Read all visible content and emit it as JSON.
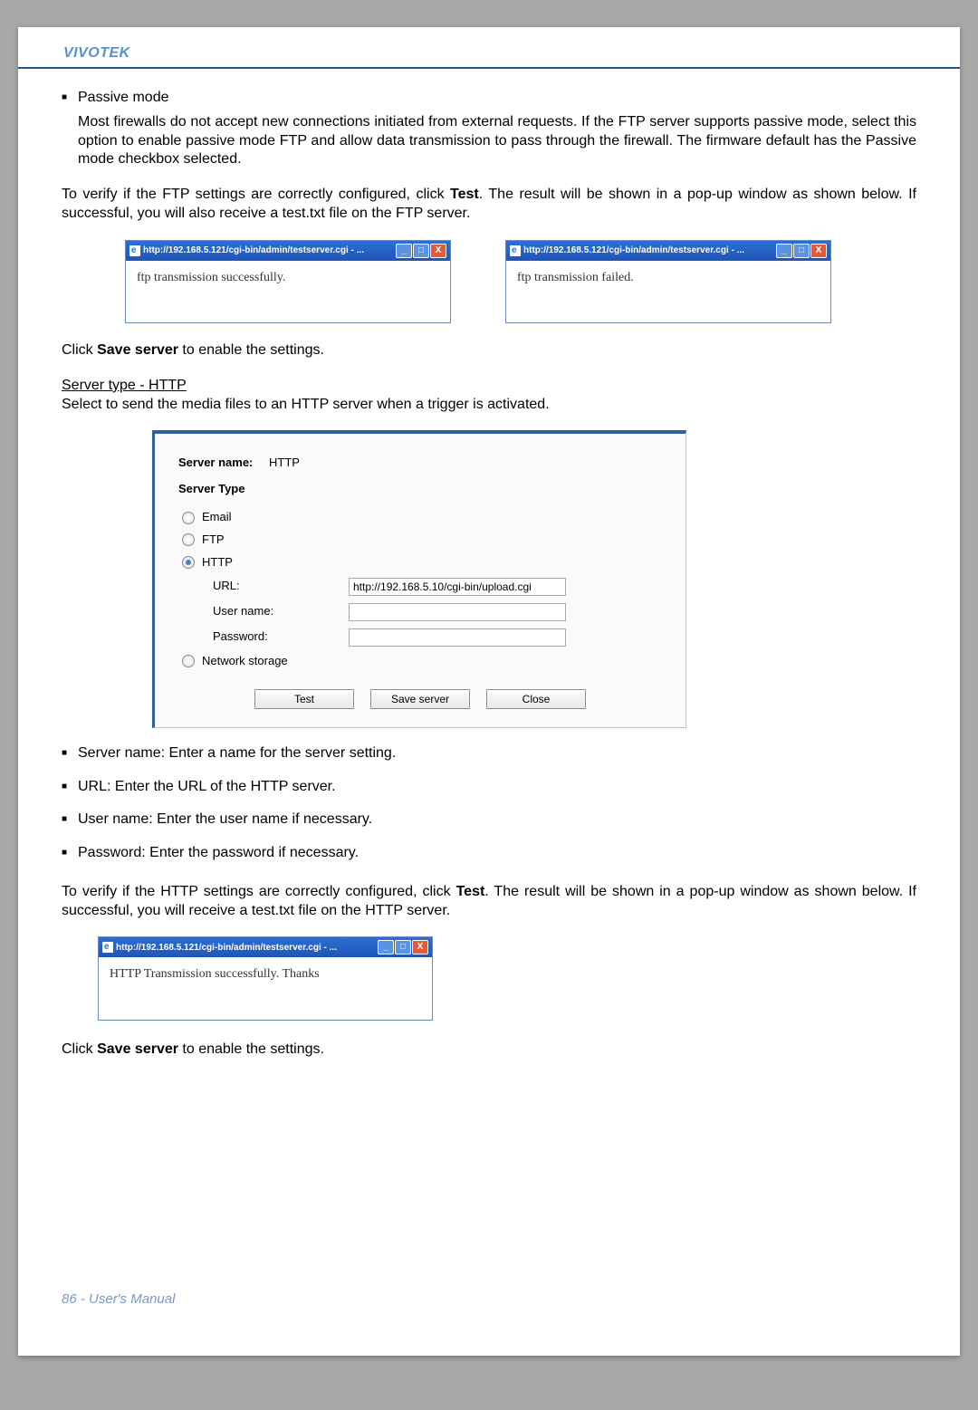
{
  "brand": "VIVOTEK",
  "passive": {
    "title": "Passive mode",
    "body": "Most firewalls do not accept new connections initiated from external requests. If the FTP server supports passive mode, select this option to enable passive mode FTP and allow data transmission to pass through the firewall. The firmware default has the Passive mode checkbox selected."
  },
  "ftp_verify": {
    "pre": "To verify if the FTP settings are correctly configured, click ",
    "word": "Test",
    "post": ". The result will be shown in a pop-up window as shown below. If successful, you will also receive a test.txt file on the FTP server."
  },
  "popup": {
    "title1": "http://192.168.5.121/cgi-bin/admin/testserver.cgi - ...",
    "body1": "ftp transmission successfully.",
    "title2": "http://192.168.5.121/cgi-bin/admin/testserver.cgi - ...",
    "body2": "ftp transmission failed."
  },
  "save_line": {
    "pre": "Click ",
    "word": "Save server",
    "post": " to enable the settings."
  },
  "http_section": {
    "title": "Server type - HTTP",
    "body": "Select to send the media files to an HTTP server when a trigger is activated."
  },
  "cfg": {
    "server_name_label": "Server name:",
    "server_name_value": "HTTP",
    "server_type": "Server Type",
    "radio_email": "Email",
    "radio_ftp": "FTP",
    "radio_http": "HTTP",
    "url_label": "URL:",
    "url_value": "http://192.168.5.10/cgi-bin/upload.cgi",
    "user_label": "User name:",
    "user_value": "",
    "pass_label": "Password:",
    "pass_value": "",
    "radio_ns": "Network storage",
    "btn_test": "Test",
    "btn_save": "Save server",
    "btn_close": "Close"
  },
  "cfg_bullets": {
    "server_name": "Server name: Enter a name for the server setting.",
    "url": "URL: Enter the URL of the HTTP server.",
    "user": "User name: Enter the user name if necessary.",
    "pass": "Password: Enter the password if necessary."
  },
  "http_verify": {
    "pre": "To verify if the HTTP settings are correctly configured, click ",
    "word": "Test",
    "post": ". The result will be shown in a pop-up window as shown below. If successful, you will receive a test.txt file on the HTTP server."
  },
  "popup3": {
    "title": "http://192.168.5.121/cgi-bin/admin/testserver.cgi - ...",
    "body": "HTTP Transmission successfully. Thanks"
  },
  "footer": "86 - User's Manual"
}
